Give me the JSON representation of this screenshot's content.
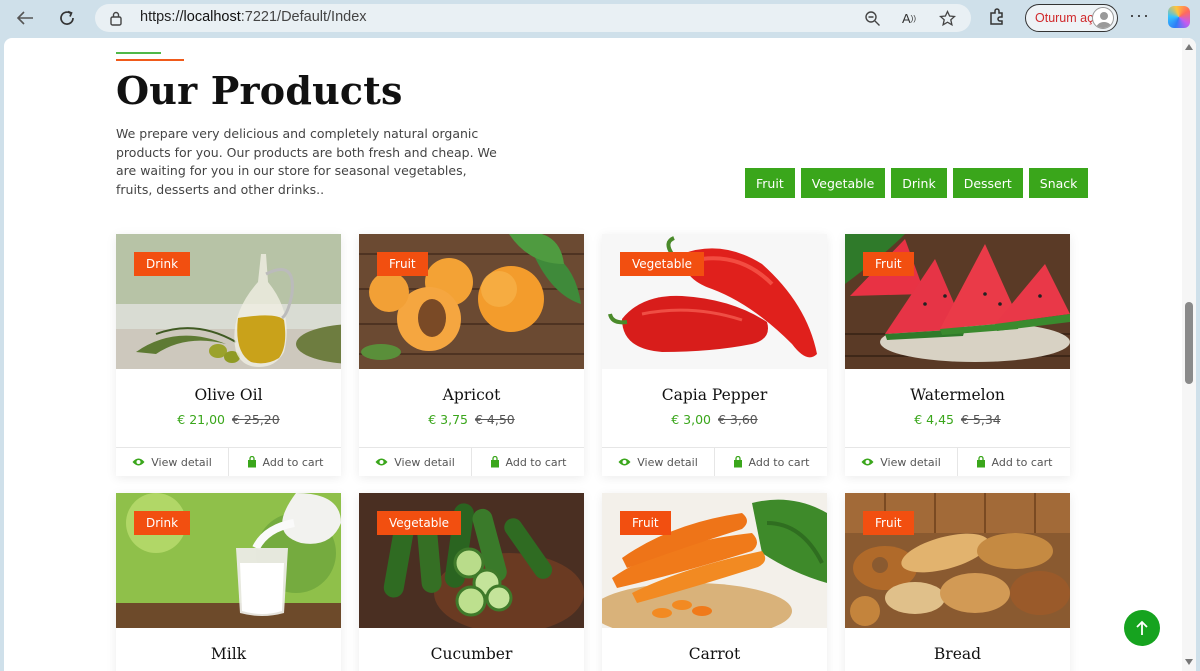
{
  "browser": {
    "url_scheme": "https://",
    "url_host": "localhost",
    "url_rest": ":7221/Default/Index",
    "signin_label": "Oturum aç",
    "read_aloud": "A"
  },
  "section": {
    "title": "Our Products",
    "description": "We prepare very delicious and completely natural organic products for you. Our products are both fresh and cheap. We are waiting for you in our store for seasonal vegetables, fruits, desserts and other drinks.."
  },
  "filters": [
    "Fruit",
    "Vegetable",
    "Drink",
    "Dessert",
    "Snack"
  ],
  "card_actions": {
    "view": "View detail",
    "cart": "Add to cart"
  },
  "products": [
    {
      "name": "Olive Oil",
      "category": "Drink",
      "price": "€ 21,00",
      "old_price": "€ 25,20",
      "image": "olive-oil"
    },
    {
      "name": "Apricot",
      "category": "Fruit",
      "price": "€ 3,75",
      "old_price": "€ 4,50",
      "image": "apricot"
    },
    {
      "name": "Capia Pepper",
      "category": "Vegetable",
      "price": "€ 3,00",
      "old_price": "€ 3,60",
      "image": "capia-pepper"
    },
    {
      "name": "Watermelon",
      "category": "Fruit",
      "price": "€ 4,45",
      "old_price": "€ 5,34",
      "image": "watermelon"
    },
    {
      "name": "Milk",
      "category": "Drink",
      "image": "milk"
    },
    {
      "name": "Cucumber",
      "category": "Vegetable",
      "image": "cucumber"
    },
    {
      "name": "Carrot",
      "category": "Fruit",
      "image": "carrot"
    },
    {
      "name": "Bread",
      "category": "Fruit",
      "image": "bread"
    }
  ],
  "colors": {
    "accent": "#3aa61b",
    "badge": "#f24f10",
    "scroll_top": "#16a31f"
  }
}
